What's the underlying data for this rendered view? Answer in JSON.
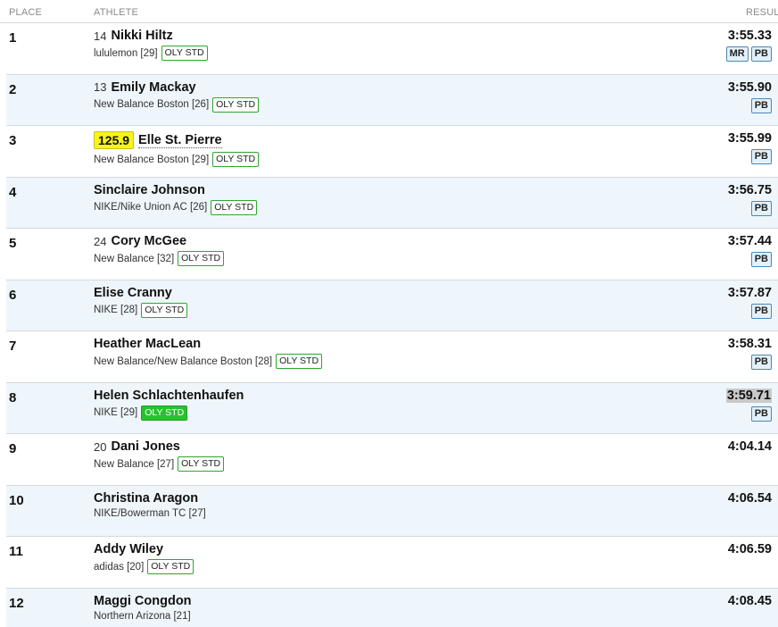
{
  "header": {
    "place_label": "PLACE",
    "athlete_label": "ATHLETE",
    "result_label": "RESULT"
  },
  "rows": [
    {
      "place": "1",
      "bib": "14",
      "name": "Nikki Hiltz",
      "team": "lululemon [29]",
      "oly": "OLY STD",
      "result": "3:55.33",
      "records": [
        "MR",
        "PB"
      ]
    },
    {
      "place": "2",
      "bib": "13",
      "name": "Emily Mackay",
      "team": "New Balance Boston [26]",
      "oly": "OLY STD",
      "result": "3:55.90",
      "records": [
        "PB"
      ]
    },
    {
      "place": "3",
      "bib": "125.9",
      "name": "Elle St. Pierre",
      "team": "New Balance Boston [29]",
      "oly": "OLY STD",
      "result": "3:55.99",
      "records": [
        "PB"
      ]
    },
    {
      "place": "4",
      "bib": "",
      "name": "Sinclaire Johnson",
      "team": "NIKE/Nike Union AC [26]",
      "oly": "OLY STD",
      "result": "3:56.75",
      "records": [
        "PB"
      ]
    },
    {
      "place": "5",
      "bib": "24",
      "name": "Cory McGee",
      "team": "New Balance [32]",
      "oly": "OLY STD",
      "result": "3:57.44",
      "records": [
        "PB"
      ]
    },
    {
      "place": "6",
      "bib": "",
      "name": "Elise Cranny",
      "team": "NIKE [28]",
      "oly": "OLY STD",
      "result": "3:57.87",
      "records": [
        "PB"
      ]
    },
    {
      "place": "7",
      "bib": "",
      "name": "Heather MacLean",
      "team": "New Balance/New Balance Boston [28]",
      "oly": "OLY STD",
      "result": "3:58.31",
      "records": [
        "PB"
      ]
    },
    {
      "place": "8",
      "bib": "",
      "name": "Helen Schlachtenhaufen",
      "team": "NIKE [29]",
      "oly": "OLY STD",
      "result": "3:59.71",
      "records": [
        "PB"
      ]
    },
    {
      "place": "9",
      "bib": "20",
      "name": "Dani Jones",
      "team": "New Balance [27]",
      "oly": "OLY STD",
      "result": "4:04.14",
      "records": []
    },
    {
      "place": "10",
      "bib": "",
      "name": "Christina Aragon",
      "team": "NIKE/Bowerman TC [27]",
      "oly": "",
      "result": "4:06.54",
      "records": []
    },
    {
      "place": "11",
      "bib": "",
      "name": "Addy Wiley",
      "team": "adidas [20]",
      "oly": "OLY STD",
      "result": "4:06.59",
      "records": []
    },
    {
      "place": "12",
      "bib": "",
      "name": "Maggi Congdon",
      "team": "Northern Arizona [21]",
      "oly": "",
      "result": "4:08.45",
      "records": []
    }
  ],
  "colors": {
    "alt_row_bg": "#eef6fb",
    "bib_highlight": "#f7f31e",
    "oly_border": "#2fa52f",
    "oly_filled": "#27c22e",
    "record_badge_bg": "#e3f1fb",
    "result_highlight": "#c9c9c9"
  }
}
